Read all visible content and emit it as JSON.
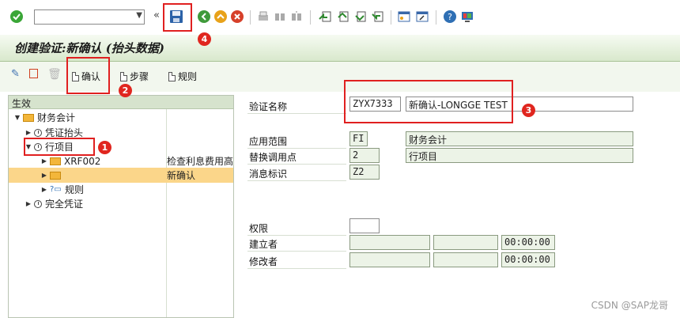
{
  "toolbar": {
    "command_value": "",
    "icons": [
      "check-icon",
      "save-icon",
      "back-icon",
      "exit-icon",
      "cancel-icon",
      "print-icon",
      "find-icon",
      "find-next-icon",
      "first-page-icon",
      "prev-page-icon",
      "next-page-icon",
      "last-page-icon",
      "new-session-icon",
      "shortcut-icon",
      "help-icon",
      "settings-icon"
    ]
  },
  "title": "创建验证:新确认 (抬头数据)",
  "app_toolbar": {
    "confirm_label": "确认",
    "step_label": "步骤",
    "rule_label": "规则"
  },
  "tree": {
    "header": "生效",
    "nodes": [
      {
        "label": "财务会计",
        "col2": ""
      },
      {
        "label": "凭证抬头",
        "col2": ""
      },
      {
        "label": "行项目",
        "col2": ""
      },
      {
        "label": "XRF002",
        "col2": "检查利息费用高"
      },
      {
        "label": "",
        "col2": "新确认"
      },
      {
        "label": "规则",
        "col2": ""
      },
      {
        "label": "完全凭证",
        "col2": ""
      }
    ]
  },
  "form": {
    "validation_name_label": "验证名称",
    "validation_id": "ZYX7333",
    "validation_desc": "新确认-LONGGE TEST",
    "app_area_label": "应用范围",
    "app_area_code": "FI",
    "app_area_text": "财务会计",
    "callup_label": "替换调用点",
    "callup_code": "2",
    "callup_text": "行项目",
    "msg_class_label": "消息标识",
    "msg_class_value": "Z2",
    "auth_label": "权限",
    "auth_value": "",
    "created_by_label": "建立者",
    "created_time": "00:00:00",
    "changed_by_label": "修改者",
    "changed_time": "00:00:00"
  },
  "annotations": [
    "1",
    "2",
    "3",
    "4"
  ],
  "watermark": "CSDN @SAP龙哥",
  "colors": {
    "annotation_red": "#e02020",
    "selected_row": "#fbd68a",
    "title_bar": "#d8e8cc"
  }
}
